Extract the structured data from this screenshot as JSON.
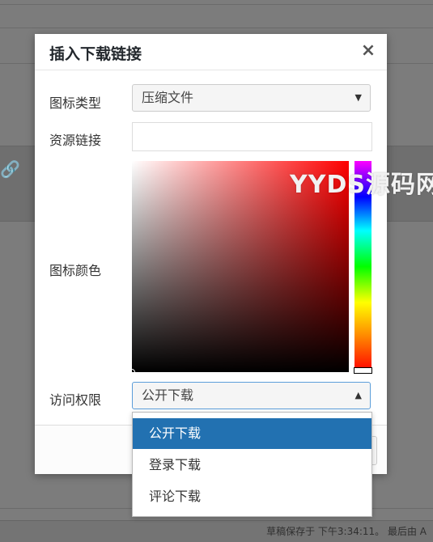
{
  "background": {
    "status_text": "草稿保存于 下午3:34:11。 最后由 A"
  },
  "watermark": "YYDS源码网",
  "modal": {
    "title": "插入下载链接",
    "close_symbol": "×",
    "fields": {
      "icon_type": {
        "label": "图标类型",
        "value": "压缩文件"
      },
      "resource_link": {
        "label": "资源链接",
        "value": ""
      },
      "icon_color": {
        "label": "图标颜色"
      },
      "access": {
        "label": "访问权限",
        "value": "公开下载"
      }
    },
    "access_options": [
      "公开下载",
      "登录下载",
      "评论下载"
    ],
    "selected_access_index": 0
  },
  "colors": {
    "accent": "#2271b1",
    "picker_hue": "#ff0000"
  }
}
